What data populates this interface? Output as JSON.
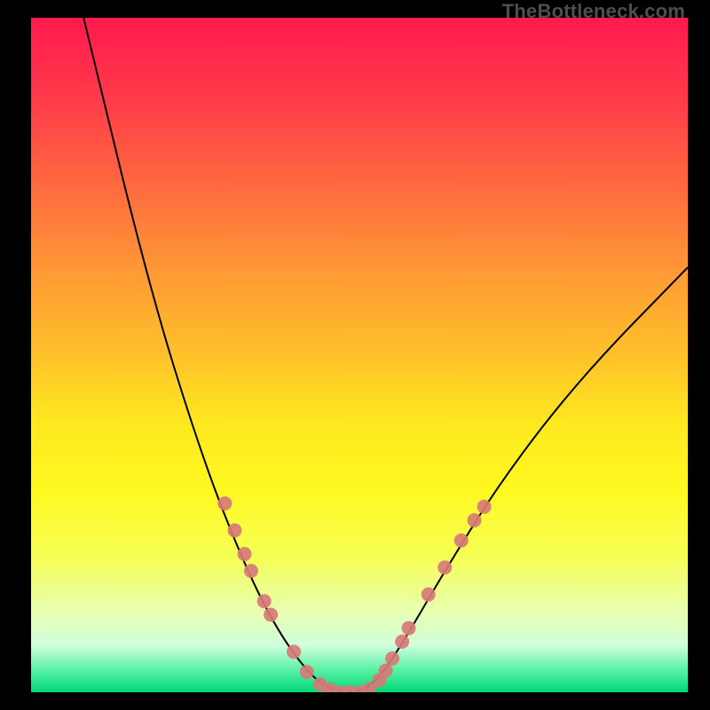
{
  "watermark": "TheBottleneck.com",
  "chart_data": {
    "type": "line",
    "title": "",
    "xlabel": "",
    "ylabel": "",
    "xlim": [
      0,
      100
    ],
    "ylim": [
      0,
      100
    ],
    "curve": {
      "points": [
        {
          "x": 8,
          "y": 100
        },
        {
          "x": 18,
          "y": 60
        },
        {
          "x": 26,
          "y": 35
        },
        {
          "x": 32,
          "y": 20
        },
        {
          "x": 37,
          "y": 10
        },
        {
          "x": 42,
          "y": 3
        },
        {
          "x": 46,
          "y": 0
        },
        {
          "x": 50,
          "y": 0
        },
        {
          "x": 53,
          "y": 2
        },
        {
          "x": 57,
          "y": 8
        },
        {
          "x": 63,
          "y": 18
        },
        {
          "x": 72,
          "y": 32
        },
        {
          "x": 84,
          "y": 47
        },
        {
          "x": 100,
          "y": 63
        }
      ]
    },
    "markers": {
      "color": "#d77a77",
      "radius_outer": 8,
      "points": [
        {
          "x": 29.5,
          "y": 28
        },
        {
          "x": 31.0,
          "y": 24
        },
        {
          "x": 32.5,
          "y": 20.5
        },
        {
          "x": 33.5,
          "y": 18
        },
        {
          "x": 35.5,
          "y": 13.5
        },
        {
          "x": 36.5,
          "y": 11.5
        },
        {
          "x": 40.0,
          "y": 6
        },
        {
          "x": 42.0,
          "y": 3
        },
        {
          "x": 44.0,
          "y": 1.2
        },
        {
          "x": 45.5,
          "y": 0.4
        },
        {
          "x": 47.0,
          "y": 0
        },
        {
          "x": 48.5,
          "y": 0
        },
        {
          "x": 50.0,
          "y": 0
        },
        {
          "x": 51.5,
          "y": 0.5
        },
        {
          "x": 53.0,
          "y": 1.8
        },
        {
          "x": 54.0,
          "y": 3.2
        },
        {
          "x": 55.0,
          "y": 5.0
        },
        {
          "x": 56.5,
          "y": 7.5
        },
        {
          "x": 57.5,
          "y": 9.5
        },
        {
          "x": 60.5,
          "y": 14.5
        },
        {
          "x": 63.0,
          "y": 18.5
        },
        {
          "x": 65.5,
          "y": 22.5
        },
        {
          "x": 67.5,
          "y": 25.5
        },
        {
          "x": 69.0,
          "y": 27.5
        }
      ]
    }
  }
}
